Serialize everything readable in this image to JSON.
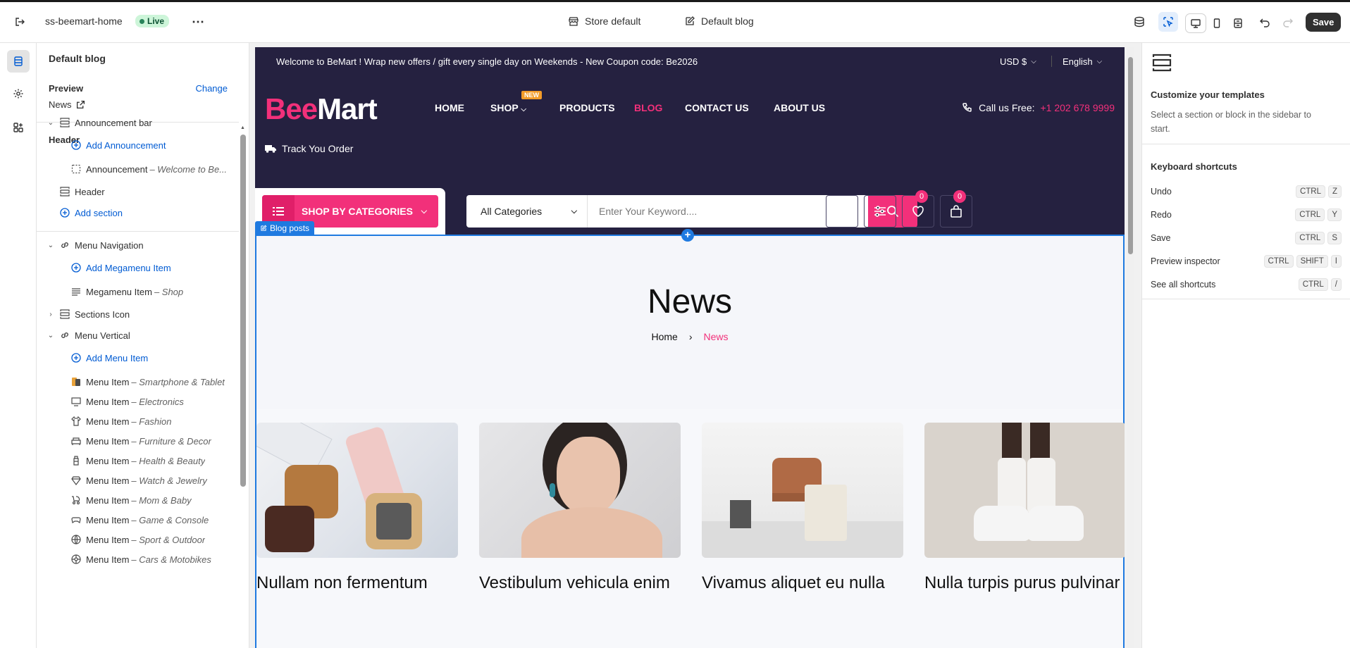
{
  "topbar": {
    "theme_name": "ss-beemart-home",
    "live_label": "Live",
    "store_label": "Store default",
    "template_label": "Default blog",
    "save_label": "Save"
  },
  "sidebar": {
    "title": "Default blog",
    "preview_label": "Preview",
    "change_label": "Change",
    "preview_value": "News",
    "header_group": "Header",
    "items": [
      {
        "label": "Announcement bar",
        "sub": "",
        "icon": "layout-icon"
      },
      {
        "label": "Add Announcement",
        "sub": "",
        "icon": "add-circle-icon"
      },
      {
        "label": "Announcement",
        "sub": "Welcome to Be...",
        "icon": "dashed-box-icon"
      },
      {
        "label": "Header",
        "sub": "",
        "icon": "layout-icon"
      },
      {
        "label": "Add section",
        "sub": "",
        "icon": "add-circle-icon"
      },
      {
        "label": "Menu Navigation",
        "sub": "",
        "icon": "link-icon"
      },
      {
        "label": "Add Megamenu Item",
        "sub": "",
        "icon": "add-circle-icon"
      },
      {
        "label": "Megamenu Item",
        "sub": "Shop",
        "icon": "text-lines-icon"
      },
      {
        "label": "Sections Icon",
        "sub": "",
        "icon": "layout-icon"
      },
      {
        "label": "Menu Vertical",
        "sub": "",
        "icon": "link-icon"
      },
      {
        "label": "Add Menu Item",
        "sub": "",
        "icon": "add-circle-icon"
      },
      {
        "label": "Menu Item",
        "sub": "Smartphone & Tablet",
        "icon": "smartphone-icon"
      },
      {
        "label": "Menu Item",
        "sub": "Electronics",
        "icon": "monitor-icon"
      },
      {
        "label": "Menu Item",
        "sub": "Fashion",
        "icon": "tshirt-icon"
      },
      {
        "label": "Menu Item",
        "sub": "Furniture & Decor",
        "icon": "sofa-icon"
      },
      {
        "label": "Menu Item",
        "sub": "Health & Beauty",
        "icon": "bottle-icon"
      },
      {
        "label": "Menu Item",
        "sub": "Watch & Jewelry",
        "icon": "diamond-icon"
      },
      {
        "label": "Menu Item",
        "sub": "Mom & Baby",
        "icon": "baby-icon"
      },
      {
        "label": "Menu Item",
        "sub": "Game & Console",
        "icon": "gamepad-icon"
      },
      {
        "label": "Menu Item",
        "sub": "Sport & Outdoor",
        "icon": "ball-icon"
      },
      {
        "label": "Menu Item",
        "sub": "Cars & Motobikes",
        "icon": "wheel-icon"
      }
    ]
  },
  "store": {
    "announcement": "Welcome to BeMart ! Wrap new offers / gift every single day on Weekends - New Coupon code: Be2026",
    "currency": "USD $",
    "language": "English",
    "logo_a": "Bee",
    "logo_b": "Mart",
    "menu": [
      "HOME",
      "SHOP",
      "PRODUCTS",
      "BLOG",
      "CONTACT US",
      "ABOUT US"
    ],
    "new_tag": "NEW",
    "call_label": "Call us Free:",
    "phone": "+1 202 678 9999",
    "track": "Track You Order",
    "shop_by": "SHOP BY CATEGORIES",
    "all_categories": "All Categories",
    "search_placeholder": "Enter Your Keyword....",
    "wishlist_count": "0",
    "cart_count": "0",
    "section_label": "Blog posts",
    "hero_title": "News",
    "crumb_home": "Home",
    "crumb_current": "News",
    "posts": [
      "Nullam non fermentum",
      "Vestibulum vehicula enim",
      "Vivamus aliquet eu nulla",
      "Nulla turpis purus pulvinar"
    ]
  },
  "rpanel": {
    "title": "Customize your templates",
    "desc": "Select a section or block in the sidebar to start.",
    "shortcuts_title": "Keyboard shortcuts",
    "shortcuts": [
      {
        "label": "Undo",
        "keys": [
          "CTRL",
          "Z"
        ]
      },
      {
        "label": "Redo",
        "keys": [
          "CTRL",
          "Y"
        ]
      },
      {
        "label": "Save",
        "keys": [
          "CTRL",
          "S"
        ]
      },
      {
        "label": "Preview inspector",
        "keys": [
          "CTRL",
          "SHIFT",
          "I"
        ]
      },
      {
        "label": "See all shortcuts",
        "keys": [
          "CTRL",
          "/"
        ]
      }
    ]
  },
  "colors": {
    "brand": "#f2307a",
    "navy": "#252140",
    "accent": "#1f7ae0"
  }
}
